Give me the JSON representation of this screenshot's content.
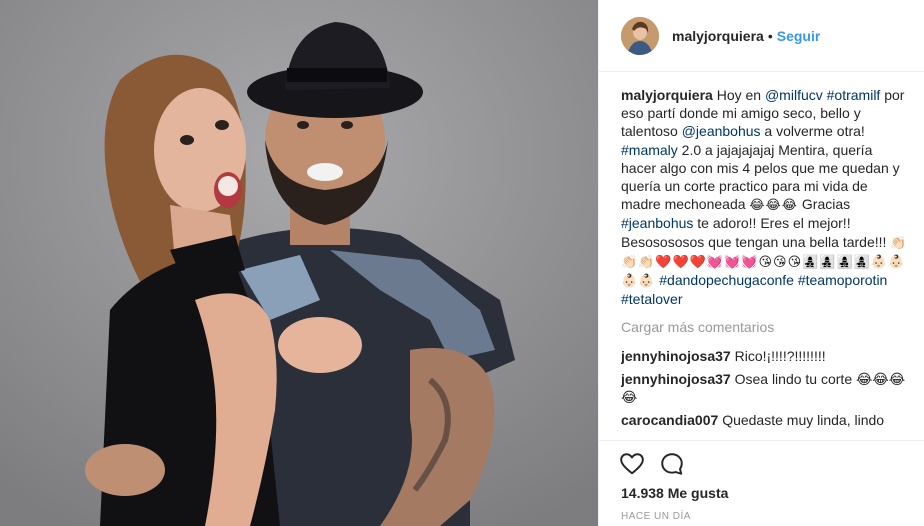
{
  "header": {
    "username": "malyjorquiera",
    "separator": "•",
    "follow_label": "Seguir"
  },
  "caption": {
    "username": "malyjorquiera",
    "t1": " Hoy en ",
    "mention_milfucv": "@milfucv",
    "t2": " ",
    "hashtag_otramilf": "#otramilf",
    "t3": " por eso partí donde mi amigo seco, bello y talentoso ",
    "mention_jeanbohus": "@jeanbohus",
    "t4": " a volverme otra! ",
    "hashtag_mamaly": "#mamaly",
    "t5": " 2.0 a jajajajajaj Mentira, quería hacer algo con mis 4 pelos que me quedan y quería un corte practico para mi vida de madre mechoneada ",
    "emoji_laugh3": "😂😂😂",
    "t6": " Gracias ",
    "hashtag_jeanbohus": "#jeanbohus",
    "t7": " te adoro!! Eres el mejor!! Besosososos que tengan una bella tarde!!! ",
    "emoji_row": "👏🏻👏🏻👏🏻❤️❤️❤️💓💓💓😘😘😘👩‍👧‍👦👩‍👧‍👦👩‍👧‍👦👩‍👧‍👦👶🏻👶🏻👶🏻👶🏻",
    "t8": " ",
    "hashtag_dandopechugaconfe": "#dandopechugaconfe",
    "t9": " ",
    "hashtag_teamoporotin": "#teamoporotin",
    "t10": " ",
    "hashtag_tetalover": "#tetalover"
  },
  "load_more_label": "Cargar más comentarios",
  "comments": [
    {
      "user": "jennyhinojosa37",
      "text": "Rico!¡!!!!?!!!!!!!!"
    },
    {
      "user": "jennyhinojosa37",
      "text": "Osea lindo tu corte 😂😂😂😂"
    },
    {
      "user": "carocandia007",
      "text": "Quedaste muy linda, lindo"
    }
  ],
  "actions": {
    "like_icon": "heart-outline-icon",
    "comment_icon": "speech-bubble-icon",
    "likes_text": "14.938 Me gusta",
    "timestamp": "Hace un día"
  },
  "colors": {
    "link": "#003569",
    "follow": "#3897f0",
    "muted": "#999999",
    "text": "#262626"
  }
}
